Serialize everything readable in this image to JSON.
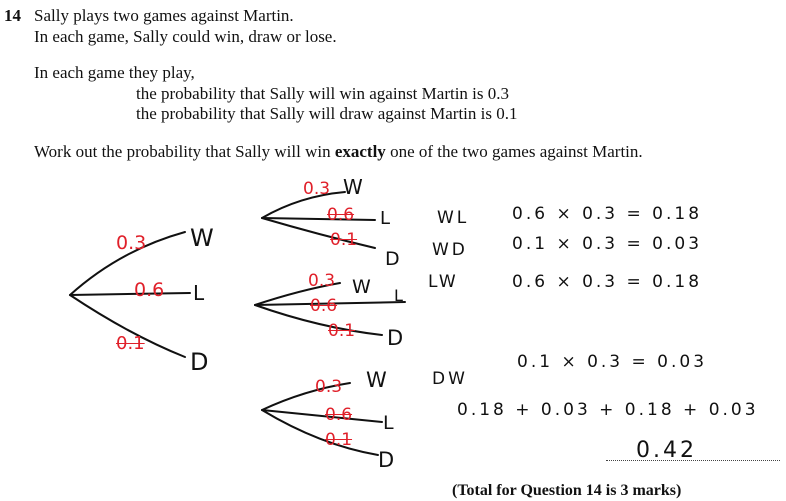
{
  "question": {
    "number": "14",
    "line1": "Sally plays two games against Martin.",
    "line2": "In each game, Sally could win, draw or lose.",
    "line3": "In each game they play,",
    "line4": "the probability that Sally will win against Martin is 0.3",
    "line5": "the probability that Sally will draw against Martin is 0.1",
    "line6_pre": "Work out the probability that Sally will win ",
    "line6_bold": "exactly",
    "line6_post": " one of the two games against Martin."
  },
  "first_game": {
    "branches": [
      {
        "prob": "0.3",
        "outcome": "W"
      },
      {
        "prob": "0.6",
        "outcome": "L"
      },
      {
        "prob": "0.1",
        "outcome": "D"
      }
    ]
  },
  "second_game_top": {
    "branches": [
      {
        "prob": "0.3",
        "outcome": "W"
      },
      {
        "prob": "0.6",
        "outcome": "L"
      },
      {
        "prob": "0.1",
        "outcome": "D"
      }
    ]
  },
  "second_game_mid": {
    "branches": [
      {
        "prob": "0.3",
        "outcome": "W"
      },
      {
        "prob": "0.6",
        "outcome": "L"
      },
      {
        "prob": "0.1",
        "outcome": "D"
      }
    ]
  },
  "second_game_bottom": {
    "branches": [
      {
        "prob": "0.3",
        "outcome": "W"
      },
      {
        "prob": "0.6",
        "outcome": "L"
      },
      {
        "prob": "0.1",
        "outcome": "D"
      }
    ]
  },
  "working": {
    "rows": [
      {
        "label": "WL",
        "calc": "0.6 × 0.3 = 0.18"
      },
      {
        "label": "WD",
        "calc": "0.1 × 0.3 = 0.03"
      },
      {
        "label": "LW",
        "calc": "0.6 × 0.3 = 0.18"
      },
      {
        "label": "DW",
        "calc": "0.1 × 0.3 = 0.03"
      }
    ],
    "sum": "0.18 + 0.03 + 0.18 + 0.03",
    "answer": "0.42"
  },
  "total": "(Total for Question 14 is 3 marks)",
  "colors": {
    "ink": "#111111",
    "red_ink": "#e0202a"
  }
}
